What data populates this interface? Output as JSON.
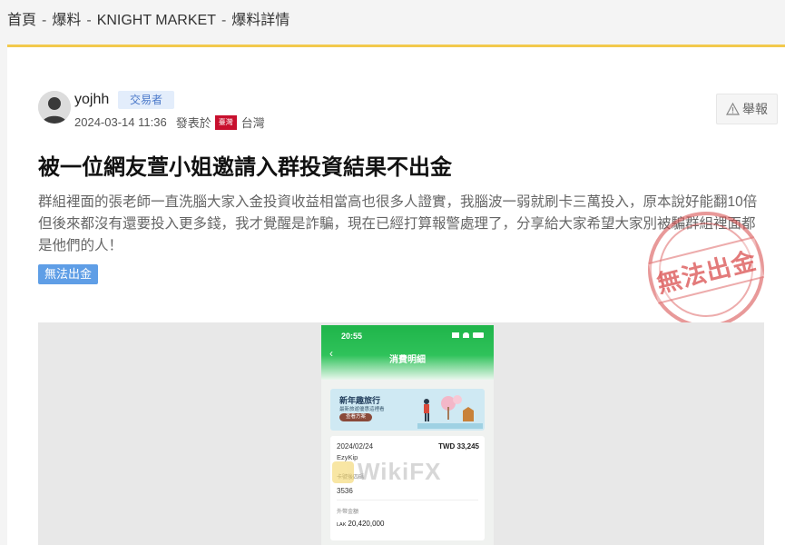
{
  "breadcrumb": {
    "home": "首頁",
    "section": "爆料",
    "broker": "KNIGHT MARKET",
    "current": "爆料詳情",
    "separator": "-"
  },
  "post": {
    "author": "yojhh",
    "role": "交易者",
    "date": "2024-03-14 11:36",
    "posted_from": "發表於",
    "flag_text": "臺灣",
    "region": "台灣",
    "report_label": "舉報",
    "title": "被一位網友萱小姐邀請入群投資結果不出金",
    "content": "群組裡面的張老師一直洗腦大家入金投資收益相當高也很多人證實，我腦波一弱就刷卡三萬投入，原本說好能翻10倍但後來都沒有還要投入更多錢，我才覺醒是詐騙，現在已經打算報警處理了，分享給大家希望大家別被騙群組裡面都是他們的人！",
    "tag": "無法出金",
    "stamp_text": "無法出金"
  },
  "screenshot": {
    "status_time": "20:55",
    "nav_title": "消費明細",
    "promo_title": "新年趣旅行",
    "promo_subtitle": "最新旅遊優惠這裡看",
    "promo_button": "查看方案",
    "txn_date": "2024/02/24",
    "txn_amount": "TWD 33,245",
    "txn_merchant": "EzyKip",
    "card_label": "卡號後四碼",
    "card_last4": "3536",
    "foreign_label": "外幣金額",
    "foreign_currency": "LAK",
    "foreign_amount": "20,420,000",
    "watermark": "WikiFX"
  },
  "colors": {
    "accent_bar": "#f2c94c",
    "badge_bg": "#e3edfb",
    "badge_text": "#4a78c9",
    "tag_bg": "#5f9ee6",
    "stamp": "#d64646",
    "app_green": "#1fb54a"
  }
}
